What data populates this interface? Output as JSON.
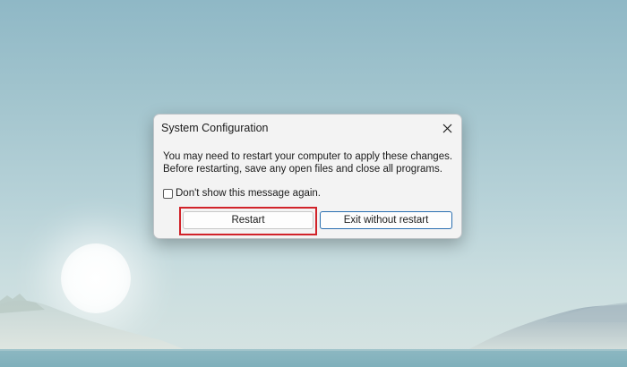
{
  "dialog": {
    "title": "System Configuration",
    "message_line1": "You may need to restart your computer to apply these changes.",
    "message_line2": "Before restarting, save any open files and close all programs.",
    "checkbox_label": "Don't show this message again.",
    "checkbox_checked": false,
    "restart_label": "Restart",
    "exit_label": "Exit without restart",
    "close_icon": "close-icon"
  },
  "colors": {
    "highlight": "#d1232a",
    "focus_border": "#2a6fb0",
    "dialog_bg": "#f3f3f3"
  }
}
